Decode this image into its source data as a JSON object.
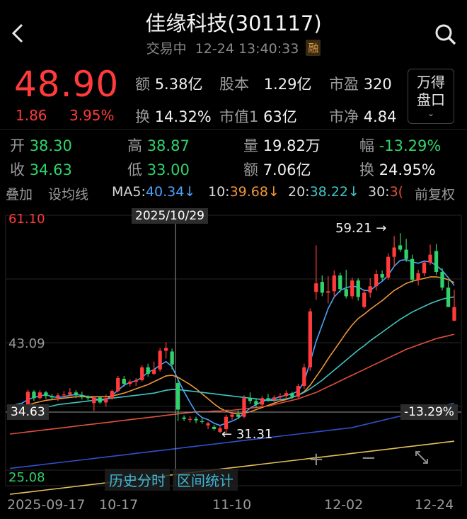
{
  "header": {
    "title": "佳缘科技(301117)",
    "trade_status": "交易中",
    "timestamp": "12-24 13:40:33",
    "margin_badge": "融",
    "back_icon": "chevron-left-icon",
    "search_icon": "search-icon"
  },
  "quote": {
    "price": "48.90",
    "change": "1.86",
    "change_pct": "3.95%",
    "amount_label": "额",
    "amount": "5.38亿",
    "share_capital_label": "股本",
    "share_capital": "1.29亿",
    "pe_label": "市盈",
    "pe": "320",
    "turnover_label": "换",
    "turnover": "14.32%",
    "market_cap_label": "市值1",
    "market_cap": "63亿",
    "pb_label": "市净",
    "pb": "4.84",
    "wind_button": [
      "万得",
      "盘口"
    ],
    "color_up": "#ff3b3b",
    "color_down": "#2fd36b"
  },
  "crosshair_info": {
    "open_label": "开",
    "open": "38.30",
    "high_label": "高",
    "high": "38.87",
    "volume_label": "量",
    "volume": "19.82万",
    "amplitude_label": "幅",
    "amplitude": "-13.29%",
    "prev_close_label": "收",
    "prev_close": "34.63",
    "low_label": "低",
    "low": "33.00",
    "amount_label": "额",
    "amount": "7.06亿",
    "turnover_label": "换",
    "turnover": "24.95%"
  },
  "toolbar": {
    "overlay": "叠加",
    "set_ma": "设均线",
    "ma5_label": "MA5:",
    "ma5": "40.34↓",
    "ma10_label": "10:",
    "ma10": "39.68↓",
    "ma20_label": "20:",
    "ma20": "38.22↓",
    "ma30_label": "30:",
    "ma30": "3(",
    "adjust": "前复权",
    "ma_colors": {
      "ma5": "#4aa3ff",
      "ma10": "#f0953a",
      "ma20": "#3fc4c4",
      "ma30": "#e0503a"
    }
  },
  "chart_labels": {
    "top_price": "61.10",
    "mid_price": "43.09",
    "bottom_price": "25.08",
    "crosshair_date": "2025/10/29",
    "crosshair_price": "34.63",
    "crosshair_pct": "-13.29%",
    "max_label": "59.21",
    "min_label": "31.31",
    "zoom_in_icon": "plus-icon",
    "zoom_out_icon": "minus-icon",
    "fullscreen_icon": "expand-icon"
  },
  "bottom_tabs": [
    "历史分时",
    "区间统计"
  ],
  "x_axis": [
    "2025-09-17",
    "10-17",
    "11-10",
    "12-02",
    "12-24"
  ],
  "chart_data": {
    "type": "candlestick",
    "ylim": [
      25.08,
      61.1
    ],
    "y_ticks": [
      61.1,
      43.09,
      25.08
    ],
    "x_ticks": [
      "2025-09-17",
      "10-17",
      "11-10",
      "12-02",
      "12-24"
    ],
    "max": 59.21,
    "min": 31.31,
    "candles": [
      {
        "o": 34.9,
        "h": 35.1,
        "l": 34.6,
        "c": 34.8
      },
      {
        "o": 34.7,
        "h": 35.4,
        "l": 34.5,
        "c": 35.3
      },
      {
        "o": 35.2,
        "h": 35.5,
        "l": 34.6,
        "c": 34.8
      },
      {
        "o": 34.8,
        "h": 37.4,
        "l": 34.8,
        "c": 37.1
      },
      {
        "o": 37.1,
        "h": 37.3,
        "l": 35.8,
        "c": 36.2
      },
      {
        "o": 36.2,
        "h": 37.3,
        "l": 36.0,
        "c": 37.0
      },
      {
        "o": 37.0,
        "h": 37.2,
        "l": 36.1,
        "c": 36.5
      },
      {
        "o": 36.5,
        "h": 36.8,
        "l": 35.9,
        "c": 36.3
      },
      {
        "o": 36.3,
        "h": 36.9,
        "l": 35.8,
        "c": 36.6
      },
      {
        "o": 36.6,
        "h": 37.2,
        "l": 36.2,
        "c": 36.7
      },
      {
        "o": 36.7,
        "h": 37.6,
        "l": 36.5,
        "c": 37.0
      },
      {
        "o": 37.0,
        "h": 37.3,
        "l": 36.2,
        "c": 36.6
      },
      {
        "o": 36.6,
        "h": 37.1,
        "l": 36.0,
        "c": 36.4
      },
      {
        "o": 36.4,
        "h": 36.6,
        "l": 35.9,
        "c": 36.2
      },
      {
        "o": 35.5,
        "h": 36.5,
        "l": 34.4,
        "c": 36.3
      },
      {
        "o": 36.3,
        "h": 36.5,
        "l": 35.4,
        "c": 35.6
      },
      {
        "o": 35.6,
        "h": 36.7,
        "l": 35.0,
        "c": 36.2
      },
      {
        "o": 36.2,
        "h": 37.4,
        "l": 36.0,
        "c": 37.2
      },
      {
        "o": 37.2,
        "h": 39.3,
        "l": 37.0,
        "c": 39.0
      },
      {
        "o": 38.9,
        "h": 39.3,
        "l": 37.8,
        "c": 38.2
      },
      {
        "o": 38.2,
        "h": 38.8,
        "l": 37.8,
        "c": 38.5
      },
      {
        "o": 38.5,
        "h": 39.0,
        "l": 37.9,
        "c": 38.7
      },
      {
        "o": 38.7,
        "h": 40.8,
        "l": 38.5,
        "c": 40.5
      },
      {
        "o": 40.5,
        "h": 41.0,
        "l": 39.2,
        "c": 39.6
      },
      {
        "o": 39.6,
        "h": 41.3,
        "l": 39.4,
        "c": 40.2
      },
      {
        "o": 40.2,
        "h": 43.2,
        "l": 39.9,
        "c": 42.8
      },
      {
        "o": 42.8,
        "h": 44.0,
        "l": 41.7,
        "c": 43.2
      },
      {
        "o": 42.7,
        "h": 43.1,
        "l": 40.2,
        "c": 40.9
      },
      {
        "o": 38.3,
        "h": 38.9,
        "l": 33.0,
        "c": 34.6
      },
      {
        "o": 33.5,
        "h": 33.8,
        "l": 33.0,
        "c": 33.3
      },
      {
        "o": 33.2,
        "h": 33.7,
        "l": 32.8,
        "c": 33.3
      },
      {
        "o": 33.3,
        "h": 33.6,
        "l": 32.7,
        "c": 33.1
      },
      {
        "o": 33.0,
        "h": 33.4,
        "l": 32.6,
        "c": 32.9
      },
      {
        "o": 32.4,
        "h": 32.9,
        "l": 31.9,
        "c": 32.7
      },
      {
        "o": 32.2,
        "h": 32.5,
        "l": 31.7,
        "c": 31.9
      },
      {
        "o": 31.5,
        "h": 32.4,
        "l": 31.3,
        "c": 32.0
      },
      {
        "o": 31.9,
        "h": 33.9,
        "l": 31.3,
        "c": 33.6
      },
      {
        "o": 33.6,
        "h": 34.3,
        "l": 33.2,
        "c": 33.9
      },
      {
        "o": 33.9,
        "h": 34.5,
        "l": 33.3,
        "c": 33.6
      },
      {
        "o": 33.6,
        "h": 36.6,
        "l": 33.4,
        "c": 36.2
      },
      {
        "o": 36.2,
        "h": 37.0,
        "l": 35.4,
        "c": 35.8
      },
      {
        "o": 35.8,
        "h": 36.2,
        "l": 34.9,
        "c": 35.3
      },
      {
        "o": 35.3,
        "h": 36.5,
        "l": 35.1,
        "c": 36.2
      },
      {
        "o": 36.2,
        "h": 36.8,
        "l": 35.7,
        "c": 36.0
      },
      {
        "o": 36.0,
        "h": 36.6,
        "l": 35.6,
        "c": 36.3
      },
      {
        "o": 36.3,
        "h": 36.9,
        "l": 35.9,
        "c": 36.5
      },
      {
        "o": 36.5,
        "h": 37.3,
        "l": 36.0,
        "c": 36.9
      },
      {
        "o": 36.9,
        "h": 37.1,
        "l": 36.1,
        "c": 36.4
      },
      {
        "o": 36.4,
        "h": 38.2,
        "l": 36.2,
        "c": 37.9
      },
      {
        "o": 37.9,
        "h": 41.0,
        "l": 37.5,
        "c": 40.5
      },
      {
        "o": 40.5,
        "h": 48.7,
        "l": 40.0,
        "c": 48.3
      },
      {
        "o": 51.0,
        "h": 57.5,
        "l": 49.9,
        "c": 52.2
      },
      {
        "o": 52.4,
        "h": 53.3,
        "l": 50.4,
        "c": 50.9
      },
      {
        "o": 50.9,
        "h": 53.2,
        "l": 49.4,
        "c": 51.1
      },
      {
        "o": 51.1,
        "h": 54.0,
        "l": 50.2,
        "c": 53.3
      },
      {
        "o": 53.3,
        "h": 53.7,
        "l": 50.9,
        "c": 51.4
      },
      {
        "o": 51.4,
        "h": 54.1,
        "l": 50.1,
        "c": 50.4
      },
      {
        "o": 50.4,
        "h": 53.0,
        "l": 50.0,
        "c": 52.6
      },
      {
        "o": 52.6,
        "h": 52.9,
        "l": 49.8,
        "c": 50.3
      },
      {
        "o": 48.9,
        "h": 51.4,
        "l": 48.7,
        "c": 50.9
      },
      {
        "o": 50.9,
        "h": 52.9,
        "l": 50.2,
        "c": 51.8
      },
      {
        "o": 51.8,
        "h": 54.1,
        "l": 51.2,
        "c": 53.5
      },
      {
        "o": 53.5,
        "h": 54.0,
        "l": 52.6,
        "c": 53.0
      },
      {
        "o": 53.0,
        "h": 56.4,
        "l": 52.7,
        "c": 55.9
      },
      {
        "o": 55.9,
        "h": 58.8,
        "l": 54.6,
        "c": 57.2
      },
      {
        "o": 57.5,
        "h": 59.2,
        "l": 56.6,
        "c": 56.9
      },
      {
        "o": 56.9,
        "h": 58.4,
        "l": 55.2,
        "c": 55.6
      },
      {
        "o": 55.6,
        "h": 56.2,
        "l": 52.3,
        "c": 52.7
      },
      {
        "o": 52.7,
        "h": 54.1,
        "l": 51.9,
        "c": 53.6
      },
      {
        "o": 53.6,
        "h": 55.4,
        "l": 53.2,
        "c": 55.1
      },
      {
        "o": 55.1,
        "h": 57.6,
        "l": 54.8,
        "c": 56.2
      },
      {
        "o": 56.7,
        "h": 57.7,
        "l": 53.4,
        "c": 53.8
      },
      {
        "o": 53.8,
        "h": 54.3,
        "l": 51.2,
        "c": 51.6
      },
      {
        "o": 51.6,
        "h": 52.5,
        "l": 49.0,
        "c": 48.9
      },
      {
        "o": 47.0,
        "h": 51.3,
        "l": 46.9,
        "c": 48.9
      }
    ],
    "ma_lines": {
      "ma5": [
        34.8,
        35.3,
        35.5,
        36.0,
        36.3,
        36.5,
        36.7,
        36.4,
        36.3,
        36.4,
        36.6,
        36.7,
        36.6,
        36.4,
        36.2,
        35.9,
        36.0,
        36.6,
        37.3,
        38.0,
        38.4,
        38.6,
        39.1,
        39.8,
        40.2,
        40.8,
        41.3,
        40.6,
        38.8,
        37.1,
        35.6,
        34.2,
        33.5,
        33.2,
        32.7,
        32.4,
        32.7,
        33.0,
        33.4,
        34.1,
        34.8,
        35.3,
        35.7,
        36.0,
        36.1,
        36.4,
        36.6,
        36.8,
        37.2,
        38.5,
        41.2,
        44.1,
        46.4,
        48.7,
        50.3,
        51.2,
        51.6,
        51.8,
        51.7,
        51.2,
        51.2,
        51.9,
        52.5,
        53.3,
        54.6,
        55.4,
        55.5,
        55.2,
        55.0,
        55.3,
        55.2,
        54.7,
        54.0,
        53.0,
        51.9
      ],
      "ma10": [
        34.3,
        34.6,
        34.9,
        35.2,
        35.5,
        35.7,
        35.9,
        36.0,
        36.1,
        36.2,
        36.3,
        36.4,
        36.4,
        36.4,
        36.4,
        36.4,
        36.4,
        36.5,
        36.7,
        36.9,
        37.2,
        37.5,
        37.8,
        38.1,
        38.5,
        38.9,
        39.3,
        39.4,
        39.1,
        38.6,
        38.1,
        37.5,
        36.8,
        36.1,
        35.4,
        34.8,
        34.4,
        34.1,
        34.0,
        34.1,
        34.3,
        34.6,
        34.9,
        35.2,
        35.5,
        35.8,
        36.0,
        36.3,
        36.6,
        37.1,
        38.0,
        39.2,
        40.4,
        41.7,
        42.9,
        44.1,
        45.3,
        46.4,
        47.3,
        47.9,
        48.6,
        49.2,
        49.8,
        50.5,
        51.2,
        51.7,
        52.2,
        52.5,
        52.7,
        52.9,
        53.1,
        53.1,
        53.0,
        52.7,
        52.3
      ],
      "ma20": [
        33.9,
        34.1,
        34.3,
        34.5,
        34.7,
        34.8,
        35.0,
        35.1,
        35.3,
        35.4,
        35.5,
        35.6,
        35.7,
        35.8,
        35.9,
        36.0,
        36.1,
        36.2,
        36.3,
        36.4,
        36.5,
        36.6,
        36.7,
        36.8,
        36.9,
        37.1,
        37.3,
        37.4,
        37.4,
        37.3,
        37.2,
        37.1,
        37.0,
        36.9,
        36.8,
        36.7,
        36.6,
        36.5,
        36.4,
        36.3,
        36.2,
        36.1,
        36.0,
        35.9,
        35.9,
        36.0,
        36.1,
        36.3,
        36.6,
        37.0,
        37.5,
        38.1,
        38.7,
        39.4,
        40.1,
        40.8,
        41.5,
        42.2,
        42.9,
        43.5,
        44.2,
        44.8,
        45.4,
        46.0,
        46.6,
        47.2,
        47.7,
        48.2,
        48.6,
        49.0,
        49.4,
        49.7,
        50.0,
        50.2,
        50.3
      ],
      "ma30": [
        31.2,
        31.3,
        31.4,
        31.5,
        31.6,
        31.7,
        31.8,
        31.9,
        32.0,
        32.1,
        32.2,
        32.3,
        32.4,
        32.5,
        32.6,
        32.7,
        32.8,
        32.9,
        33.0,
        33.1,
        33.2,
        33.3,
        33.4,
        33.5,
        33.6,
        33.7,
        33.8,
        33.9,
        34.0,
        34.1,
        34.2,
        34.3,
        34.3,
        34.3,
        34.4,
        34.4,
        34.5,
        34.5,
        34.6,
        34.7,
        34.8,
        34.9,
        35.0,
        35.1,
        35.3,
        35.5,
        35.7,
        35.9,
        36.1,
        36.4,
        36.7,
        37.0,
        37.4,
        37.8,
        38.2,
        38.6,
        39.0,
        39.4,
        39.8,
        40.2,
        40.6,
        41.0,
        41.4,
        41.8,
        42.2,
        42.6,
        43.0,
        43.3,
        43.6,
        43.9,
        44.2,
        44.5,
        44.7,
        44.9,
        45.1
      ],
      "ma60": [
        26.4,
        26.5,
        26.6,
        26.7,
        26.8,
        26.9,
        27.0,
        27.1,
        27.2,
        27.3,
        27.4,
        27.5,
        27.6,
        27.7,
        27.8,
        27.9,
        28.0,
        28.1,
        28.2,
        28.3,
        28.4,
        28.5,
        28.6,
        28.7,
        28.8,
        28.9,
        29.0,
        29.1,
        29.2,
        29.3,
        29.4,
        29.5,
        29.6,
        29.7,
        29.8,
        29.9,
        30.0,
        30.1,
        30.2,
        30.3,
        30.4,
        30.5,
        30.6,
        30.7,
        30.8,
        30.9,
        31.0,
        31.1,
        31.2,
        31.3,
        31.4,
        31.5,
        31.6,
        31.7,
        31.8,
        31.9,
        32.0,
        32.1,
        32.3,
        32.5,
        32.7,
        32.9,
        33.1,
        33.3,
        33.5,
        33.7,
        33.9,
        34.1,
        34.3,
        34.5,
        34.7,
        34.9,
        35.1,
        35.3,
        35.5
      ],
      "ma120": [
        22.8,
        22.9,
        23.0,
        23.1,
        23.2,
        23.3,
        23.4,
        23.5,
        23.6,
        23.7,
        23.8,
        23.9,
        24.0,
        24.1,
        24.2,
        24.3,
        24.4,
        24.5,
        24.6,
        24.7,
        24.8,
        24.9,
        25.0,
        25.1,
        25.2,
        25.3,
        25.4,
        25.5,
        25.6,
        25.7,
        25.8,
        25.9,
        26.0,
        26.1,
        26.2,
        26.3,
        26.4,
        26.5,
        26.6,
        26.7,
        26.8,
        26.9,
        27.0,
        27.1,
        27.2,
        27.3,
        27.4,
        27.5,
        27.6,
        27.7,
        27.8,
        27.9,
        28.0,
        28.1,
        28.2,
        28.3,
        28.4,
        28.5,
        28.6,
        28.7,
        28.8,
        28.9,
        29.0,
        29.1,
        29.2,
        29.3,
        29.4,
        29.5,
        29.6,
        29.7,
        29.8,
        29.9,
        30.0,
        30.1,
        30.2
      ]
    },
    "ma_line_colors": {
      "ma5": "#4aa3ff",
      "ma10": "#f0953a",
      "ma20": "#3fc4c4",
      "ma30": "#e0503a",
      "ma60": "#3050c8",
      "ma120": "#e3c05a"
    }
  }
}
